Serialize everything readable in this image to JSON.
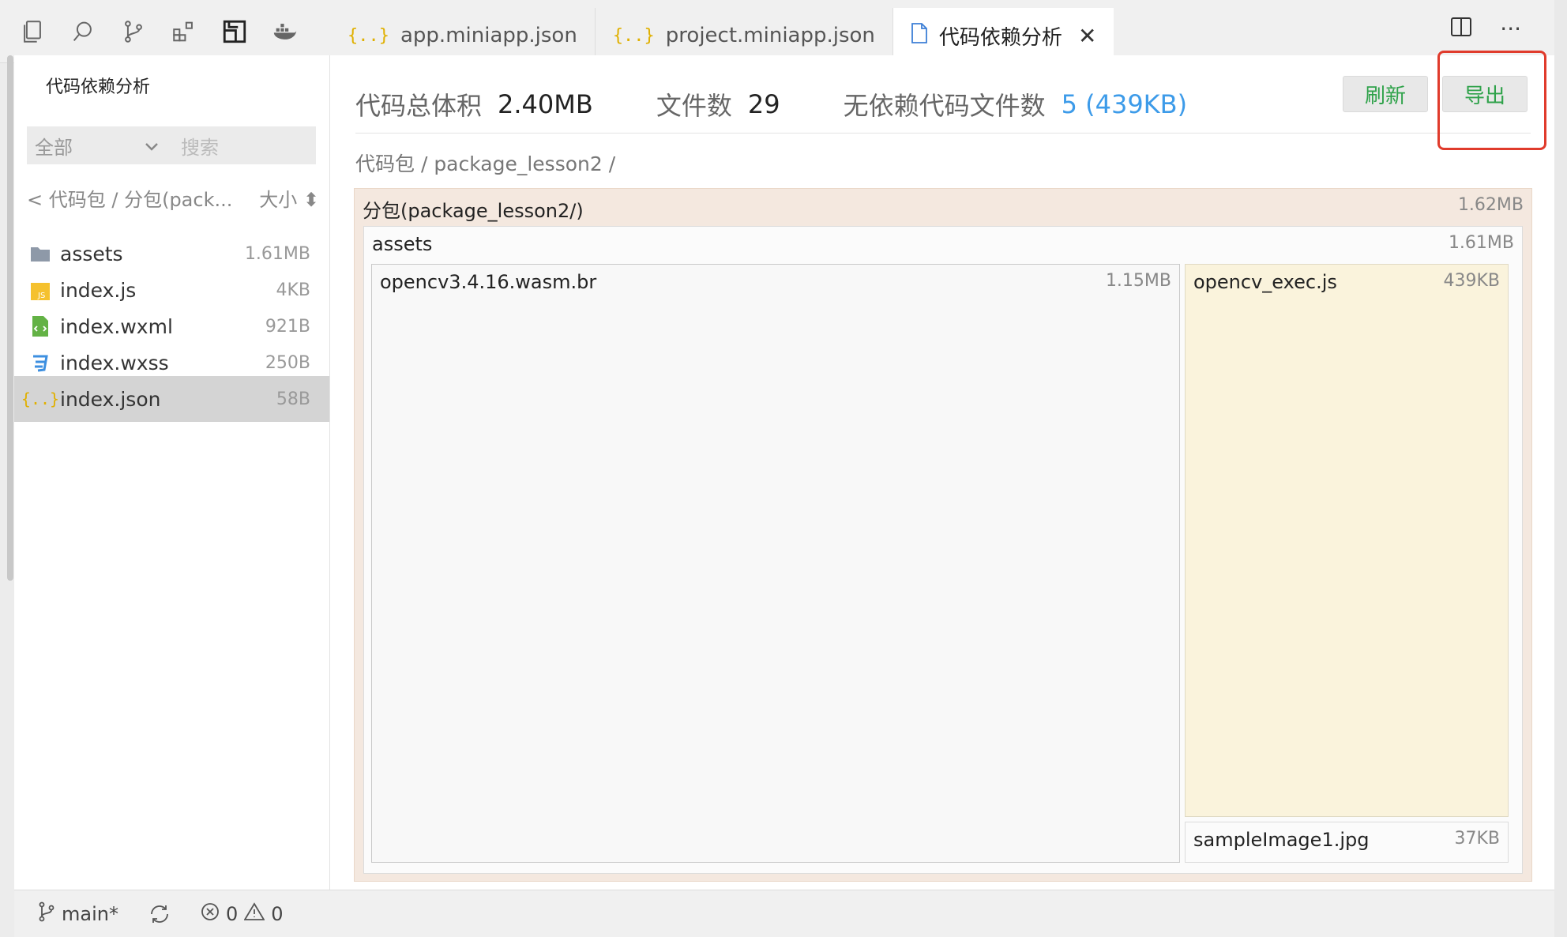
{
  "tabs": [
    {
      "label": "app.miniapp.json",
      "icon": "json-braces-icon"
    },
    {
      "label": "project.miniapp.json",
      "icon": "json-braces-icon"
    },
    {
      "label": "代码依赖分析",
      "icon": "file-icon",
      "active": true
    }
  ],
  "top_right": {
    "split": "split-editor-icon",
    "more": "···"
  },
  "left": {
    "title": "代码依赖分析",
    "filter_value": "全部",
    "search_placeholder": "搜索",
    "crumb": "< 代码包 / 分包(pack...",
    "sort_label": "大小 ⬍",
    "files": [
      {
        "name": "assets",
        "size": "1.61MB",
        "icon": "folder-icon"
      },
      {
        "name": "index.js",
        "size": "4KB",
        "icon": "js-file-icon"
      },
      {
        "name": "index.wxml",
        "size": "921B",
        "icon": "wxml-file-icon"
      },
      {
        "name": "index.wxss",
        "size": "250B",
        "icon": "css-file-icon"
      },
      {
        "name": "index.json",
        "size": "58B",
        "icon": "json-file-icon",
        "selected": true
      }
    ]
  },
  "summary": {
    "total_label": "代码总体积",
    "total_value": "2.40MB",
    "count_label": "文件数",
    "count_value": "29",
    "nodep_label": "无依赖代码文件数",
    "nodep_value": "5 (439KB)"
  },
  "buttons": {
    "refresh": "刷新",
    "export": "导出"
  },
  "path": "代码包 / package_lesson2 /",
  "treemap": {
    "root": {
      "label": "分包(package_lesson2/)",
      "size": "1.62MB"
    },
    "assets": {
      "label": "assets",
      "size": "1.61MB"
    },
    "wasm": {
      "label": "opencv3.4.16.wasm.br",
      "size": "1.15MB"
    },
    "exec": {
      "label": "opencv_exec.js",
      "size": "439KB"
    },
    "sample": {
      "label": "sampleImage1.jpg",
      "size": "37KB"
    }
  },
  "status": {
    "branch": "main*",
    "errors": "0",
    "warnings": "0"
  },
  "colors": {
    "accent_green": "#2fa24a",
    "link_blue": "#3d9be9",
    "highlight_red": "#e03b2c"
  }
}
